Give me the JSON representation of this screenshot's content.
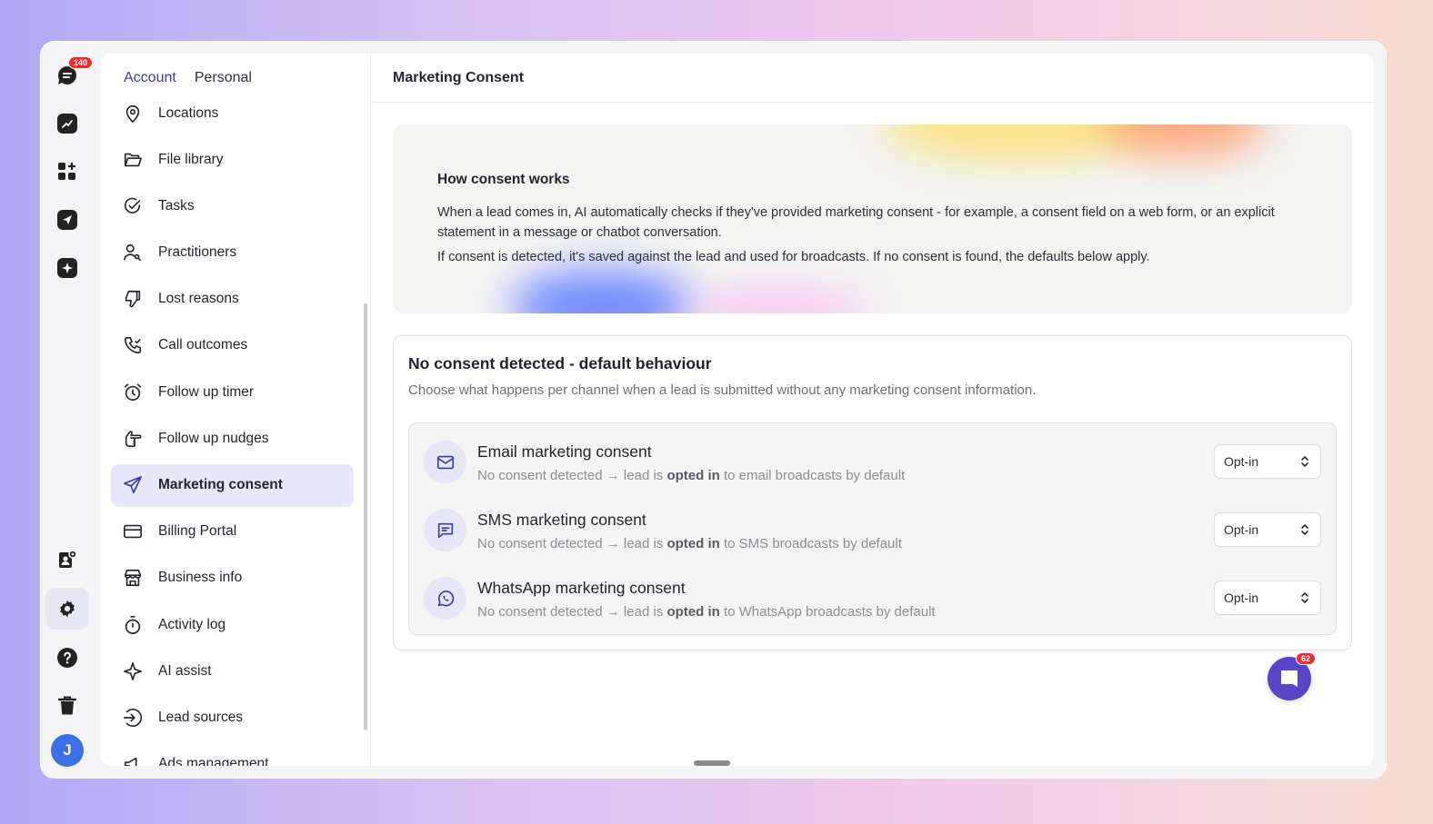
{
  "rail": {
    "notification_count": "140",
    "avatar_initial": "J"
  },
  "tabs": [
    "Account",
    "Personal"
  ],
  "nav": {
    "items": [
      {
        "label": "Locations",
        "icon": "location-pin-icon"
      },
      {
        "label": "File library",
        "icon": "folder-icon"
      },
      {
        "label": "Tasks",
        "icon": "check-circle-icon"
      },
      {
        "label": "Practitioners",
        "icon": "user-icon"
      },
      {
        "label": "Lost reasons",
        "icon": "thumbs-down-icon"
      },
      {
        "label": "Call outcomes",
        "icon": "phone-icon"
      },
      {
        "label": "Follow up timer",
        "icon": "alarm-icon"
      },
      {
        "label": "Follow up nudges",
        "icon": "pointing-hand-icon"
      },
      {
        "label": "Marketing consent",
        "icon": "send-icon"
      },
      {
        "label": "Billing Portal",
        "icon": "credit-card-icon"
      },
      {
        "label": "Business info",
        "icon": "store-icon"
      },
      {
        "label": "Activity log",
        "icon": "stopwatch-icon"
      },
      {
        "label": "AI assist",
        "icon": "sparkle-icon"
      },
      {
        "label": "Lead sources",
        "icon": "login-arrow-icon"
      },
      {
        "label": "Ads management",
        "icon": "megaphone-icon"
      }
    ]
  },
  "main": {
    "title": "Marketing Consent",
    "info": {
      "title": "How consent works",
      "paragraph1": "When a lead comes in, AI automatically checks if they've provided marketing consent - for example, a consent field on a web form, or an explicit statement in a message or chatbot conversation.",
      "paragraph2": "If consent is detected, it's saved against the lead and used for broadcasts. If no consent is found, the defaults below apply."
    },
    "default_section": {
      "title": "No consent detected - default behaviour",
      "subtitle": "Choose what happens per channel when a lead is submitted without any marketing consent information."
    },
    "channels": [
      {
        "title": "Email marketing consent",
        "desc_prefix": "No consent detected → lead is ",
        "desc_bold": "opted in",
        "desc_suffix": " to email broadcasts by default",
        "value": "Opt-in",
        "icon": "mail-icon"
      },
      {
        "title": "SMS marketing consent",
        "desc_prefix": "No consent detected → lead is ",
        "desc_bold": "opted in",
        "desc_suffix": " to SMS broadcasts by default",
        "value": "Opt-in",
        "icon": "chat-bubble-icon"
      },
      {
        "title": "WhatsApp marketing consent",
        "desc_prefix": "No consent detected → lead is ",
        "desc_bold": "opted in",
        "desc_suffix": " to WhatsApp broadcasts by default",
        "value": "Opt-in",
        "icon": "whatsapp-icon"
      }
    ]
  },
  "chat_badge": "62",
  "colors": {
    "accent": "#3a3ca6",
    "active_bg": "#e7e7fa",
    "badge_red": "#ef2b2b",
    "fab_purple": "#5a45c9"
  }
}
